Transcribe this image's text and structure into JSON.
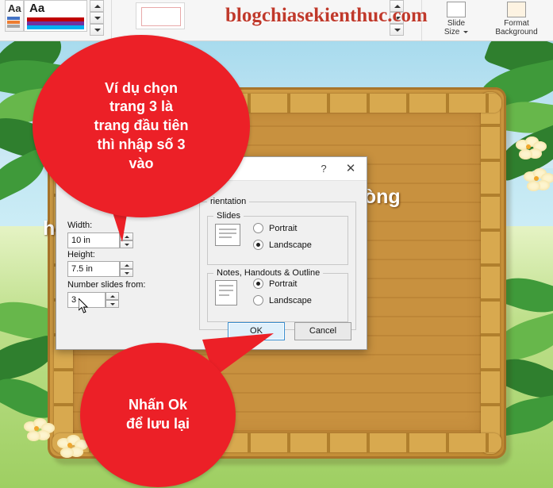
{
  "ribbon": {
    "wordart_sample": "Aa",
    "quick_styles_sample": "Aa",
    "buttons": [
      {
        "label": "Slide\nSize",
        "icon": "page-icon",
        "has_caret": true
      },
      {
        "label": "Format\nBackground",
        "icon": "fill-icon",
        "has_caret": false
      }
    ]
  },
  "watermark": "blogchiasekienthuc.com",
  "slide": {
    "line1": "hiếu, phòng",
    "line2": "họ"
  },
  "dialog": {
    "title": "",
    "help_icon": "?",
    "close_icon": "✕",
    "width_label": "Width:",
    "width_value": "10 in",
    "height_label": "Height:",
    "height_value": "7.5 in",
    "number_label": "Number slides from:",
    "number_value": "3",
    "orientation_label": "rientation",
    "slides_group_label": "Slides",
    "notes_group_label": "Notes, Handouts & Outline",
    "slides_portrait": "Portrait",
    "slides_landscape": "Landscape",
    "notes_portrait": "Portrait",
    "notes_landscape": "Landscape",
    "slides_selected": "Landscape",
    "notes_selected": "Portrait",
    "ok_button": "OK",
    "cancel_button": "Cancel"
  },
  "callouts": [
    {
      "id": "callout-top",
      "text": "Ví dụ chọn\ntrang 3 là\ntrang đầu tiên\nthì nhập số 3\nvào"
    },
    {
      "id": "callout-bottom",
      "text": "Nhấn Ok\nđể lưu lại"
    }
  ],
  "colors": {
    "callout_red": "#ec2027",
    "watermark_red": "#c0392b",
    "board_wood": "#c8913f",
    "primary_button": "#dff0fb"
  }
}
